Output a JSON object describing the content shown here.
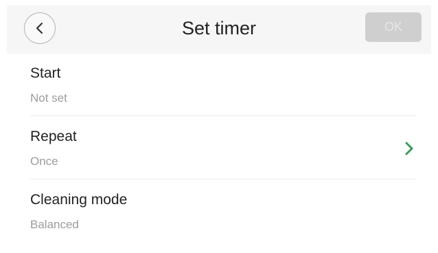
{
  "header": {
    "title": "Set timer",
    "ok_label": "OK"
  },
  "rows": [
    {
      "label": "Start",
      "value": "Not set"
    },
    {
      "label": "Repeat",
      "value": "Once"
    },
    {
      "label": "Cleaning mode",
      "value": "Balanced"
    }
  ],
  "icons": {
    "back": "chevron-left-icon",
    "repeat_arrow": "chevron-right-icon"
  },
  "colors": {
    "header_bg": "#f6f6f6",
    "ok_disabled_bg": "#cfcfcf",
    "chevron_accent": "#3a9a5a",
    "label_text": "#222222",
    "value_text": "#9c9c9c"
  }
}
